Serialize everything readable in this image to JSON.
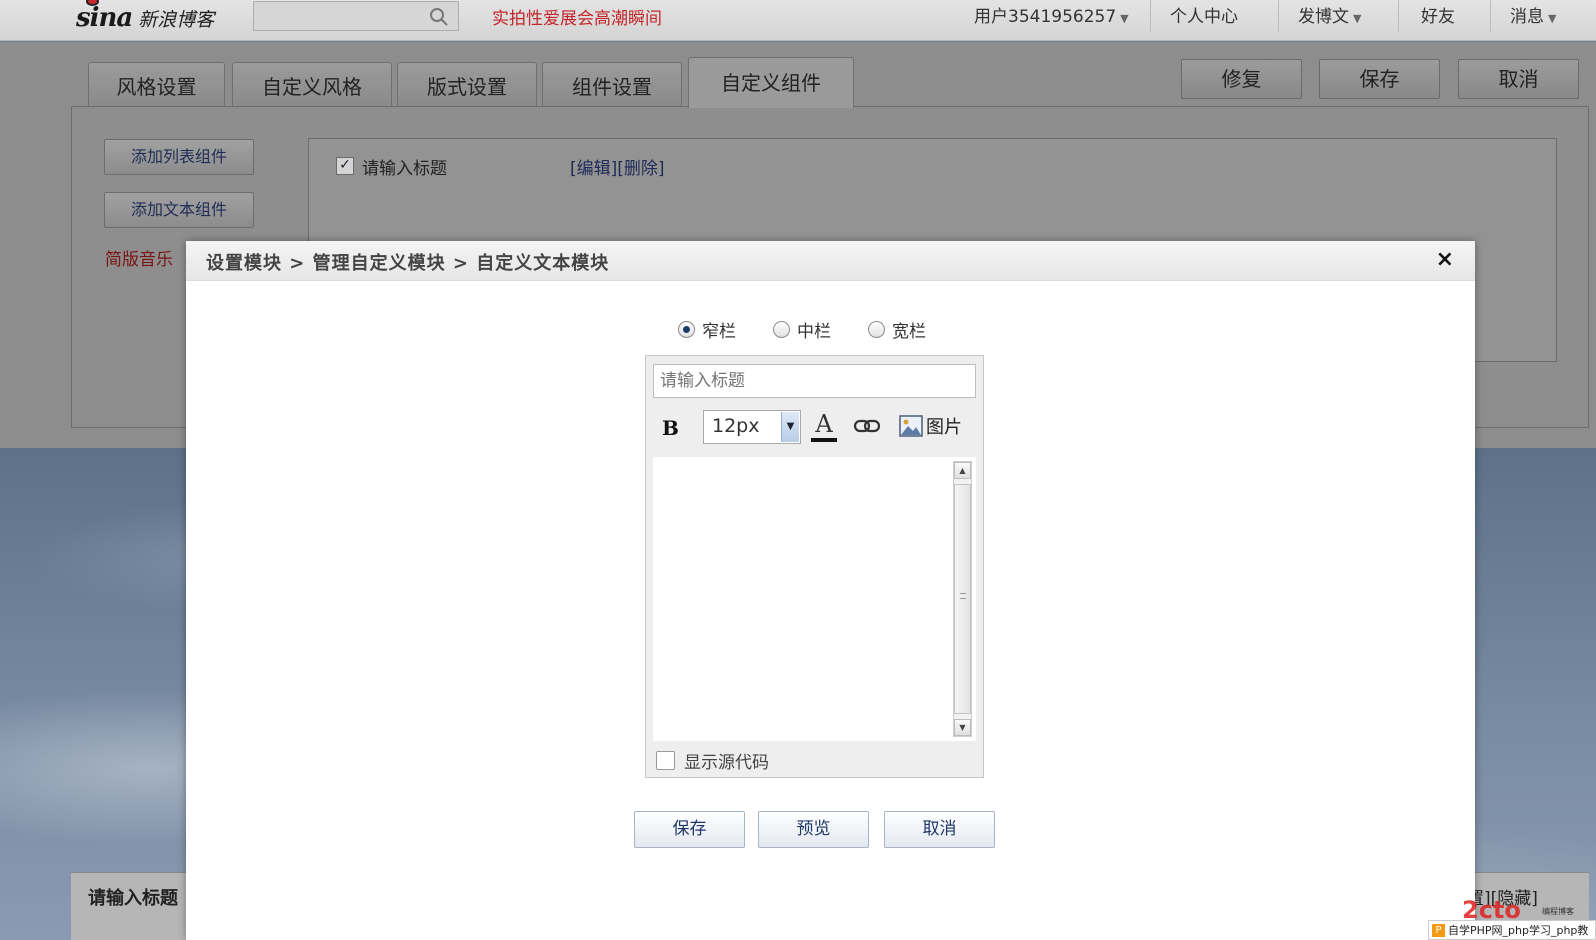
{
  "topbar": {
    "logo_text": "sina",
    "blog_name": "新浪博客",
    "search_placeholder": "",
    "headline": "实拍性爱展会高潮瞬间",
    "nav": {
      "user": "用户3541956257",
      "personal_center": "个人中心",
      "post": "发博文",
      "friends": "好友",
      "messages": "消息"
    }
  },
  "settings": {
    "tabs": [
      "风格设置",
      "自定义风格",
      "版式设置",
      "组件设置",
      "自定义组件"
    ],
    "active_tab": "自定义组件",
    "actions": {
      "repair": "修复",
      "save": "保存",
      "cancel": "取消"
    },
    "add_list_label": "添加列表组件",
    "add_text_label": "添加文本组件",
    "music_link": "简版音乐",
    "list_item_title": "请输入标题",
    "list_item_links": "[编辑][删除]"
  },
  "modal": {
    "title": "设置模块 > 管理自定义模块 > 自定义文本模块",
    "close": "×",
    "width_options": {
      "narrow": "窄栏",
      "medium": "中栏",
      "wide": "宽栏"
    },
    "selected_width": "窄栏",
    "title_placeholder": "请输入标题",
    "toolbar": {
      "bold": "B",
      "font_size": "12px",
      "color_letter": "A",
      "image_label": "图片"
    },
    "show_source_label": "显示源代码",
    "buttons": {
      "save": "保存",
      "preview": "预览",
      "cancel": "取消"
    }
  },
  "bottom": {
    "title": "请输入标题",
    "links": "置][隐藏]"
  },
  "watermark": {
    "tiny_text": "编程博客",
    "bar_text": "自学PHP网_php学习_php教"
  },
  "colors": {
    "headline": "#c4262b",
    "music_link": "#7a1414",
    "link_blue": "#1f3766"
  }
}
